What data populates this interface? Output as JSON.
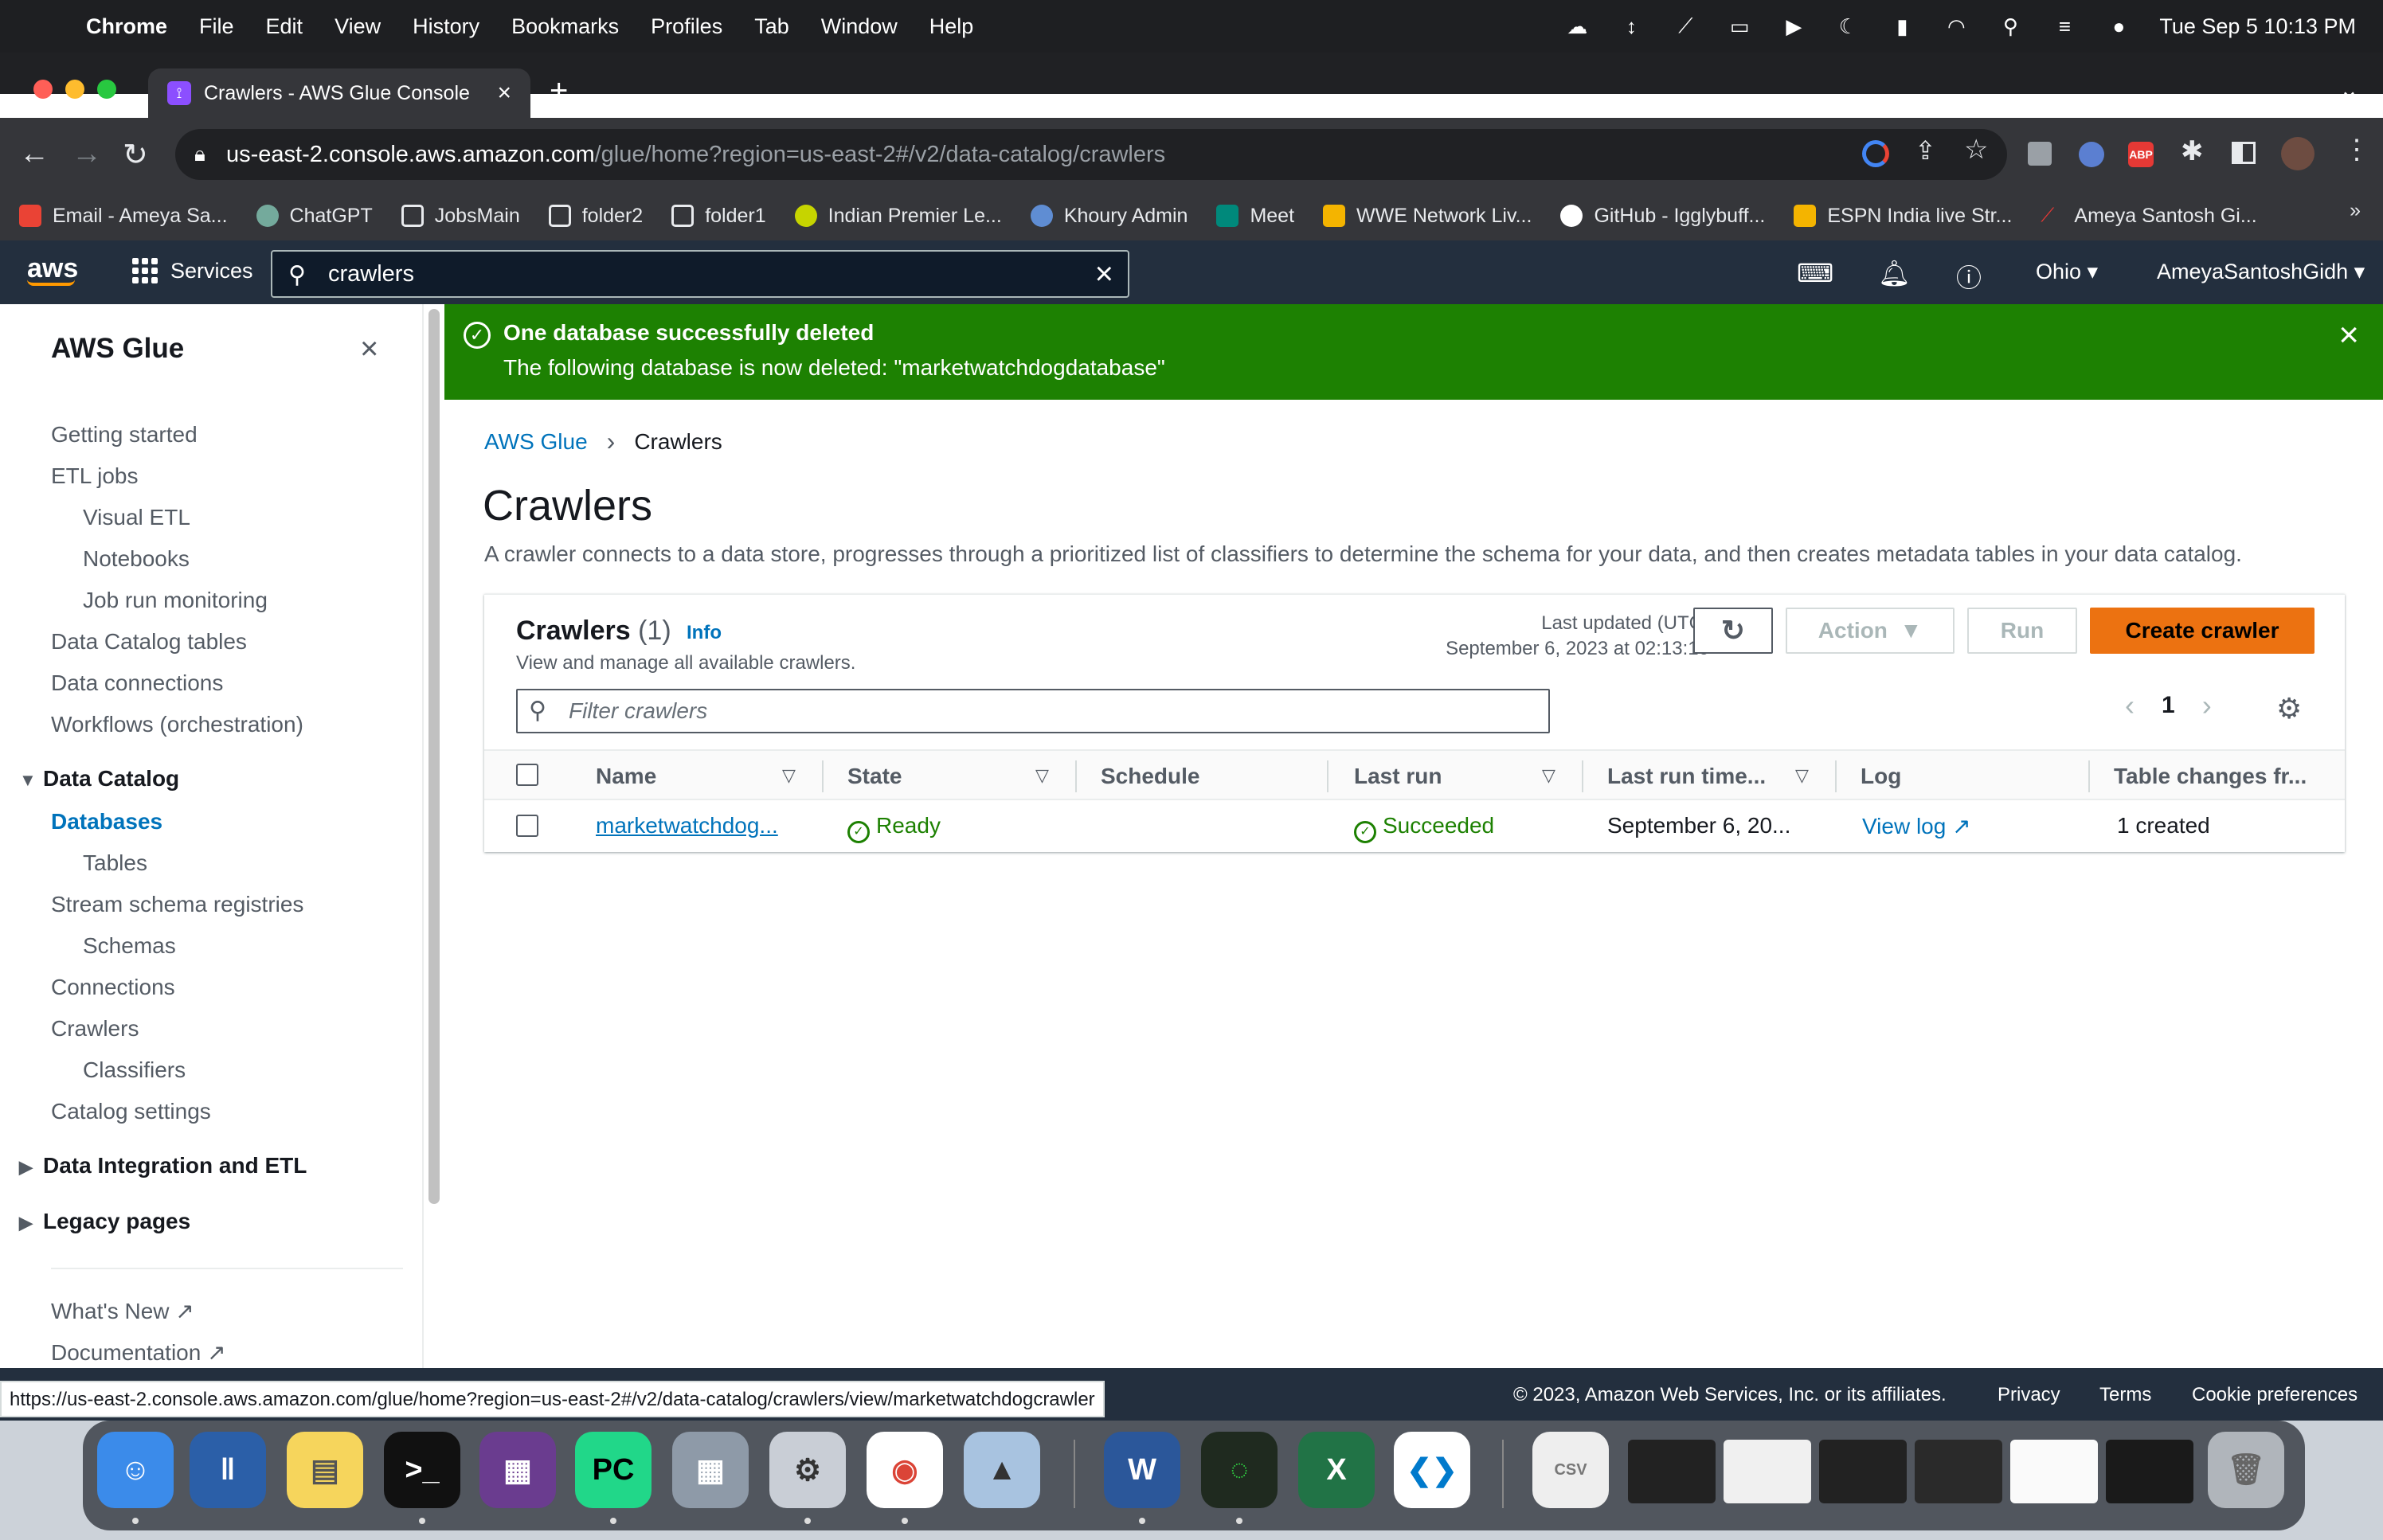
{
  "menubar": {
    "app": "Chrome",
    "items": [
      "File",
      "Edit",
      "View",
      "History",
      "Bookmarks",
      "Profiles",
      "Tab",
      "Window",
      "Help"
    ],
    "datetime": "Tue Sep 5  10:13 PM"
  },
  "browser": {
    "tab_title": "Crawlers - AWS Glue Console",
    "url_host": "us-east-2.console.aws.amazon.com",
    "url_path": "/glue/home?region=us-east-2#/v2/data-catalog/crawlers",
    "bookmarks": [
      "Email - Ameya Sa...",
      "ChatGPT",
      "JobsMain",
      "folder2",
      "folder1",
      "Indian Premier Le...",
      "Khoury Admin",
      "Meet",
      "WWE Network Liv...",
      "GitHub - Igglybuff...",
      "ESPN India live Str...",
      "Ameya Santosh Gi..."
    ],
    "bookmarks_more": "»"
  },
  "awsnav": {
    "logo": "aws",
    "services_label": "Services",
    "search_value": "crawlers",
    "region": "Ohio",
    "account": "AmeyaSantoshGidh"
  },
  "sidebar": {
    "title": "AWS Glue",
    "items": {
      "getting_started": "Getting started",
      "etl_jobs": "ETL jobs",
      "visual_etl": "Visual ETL",
      "notebooks": "Notebooks",
      "job_run_monitoring": "Job run monitoring",
      "data_catalog_tables": "Data Catalog tables",
      "data_connections": "Data connections",
      "workflows": "Workflows (orchestration)",
      "data_catalog": "Data Catalog",
      "databases": "Databases",
      "tables": "Tables",
      "stream_schema_registries": "Stream schema registries",
      "schemas": "Schemas",
      "connections": "Connections",
      "crawlers": "Crawlers",
      "classifiers": "Classifiers",
      "catalog_settings": "Catalog settings",
      "data_integration": "Data Integration and ETL",
      "legacy_pages": "Legacy pages",
      "whats_new": "What's New",
      "documentation": "Documentation"
    }
  },
  "flash": {
    "title": "One database successfully deleted",
    "message": "The following database is now deleted: \"marketwatchdogdatabase\""
  },
  "breadcrumb": [
    "AWS Glue",
    "Crawlers"
  ],
  "page": {
    "title": "Crawlers",
    "description": "A crawler connects to a data store, progresses through a prioritized list of classifiers to determine the schema for your data, and then creates metadata tables in your data catalog."
  },
  "panel": {
    "title": "Crawlers",
    "count": "(1)",
    "info": "Info",
    "subtitle": "View and manage all available crawlers.",
    "last_updated_label": "Last updated (UTC)",
    "last_updated_value": "September 6, 2023 at 02:13:10",
    "action_label": "Action",
    "run_label": "Run",
    "create_label": "Create crawler",
    "filter_placeholder": "Filter crawlers",
    "page": "1",
    "columns": [
      "Name",
      "State",
      "Schedule",
      "Last run",
      "Last run time...",
      "Log",
      "Table changes fr..."
    ],
    "rows": [
      {
        "name": "marketwatchdog...",
        "state": "Ready",
        "schedule": "",
        "last_run": "Succeeded",
        "last_run_time": "September 6, 20...",
        "log": "View log",
        "table_changes": "1 created"
      }
    ]
  },
  "footer": {
    "copyright": "© 2023, Amazon Web Services, Inc. or its affiliates.",
    "privacy": "Privacy",
    "terms": "Terms",
    "cookies": "Cookie preferences"
  },
  "status_url": "https://us-east-2.console.aws.amazon.com/glue/home?region=us-east-2#/v2/data-catalog/crawlers/view/marketwatchdogcrawler",
  "colors": {
    "aws_nav": "#232f3e",
    "success": "#1d8102",
    "primary_button": "#ec7211",
    "link": "#0073bb"
  }
}
